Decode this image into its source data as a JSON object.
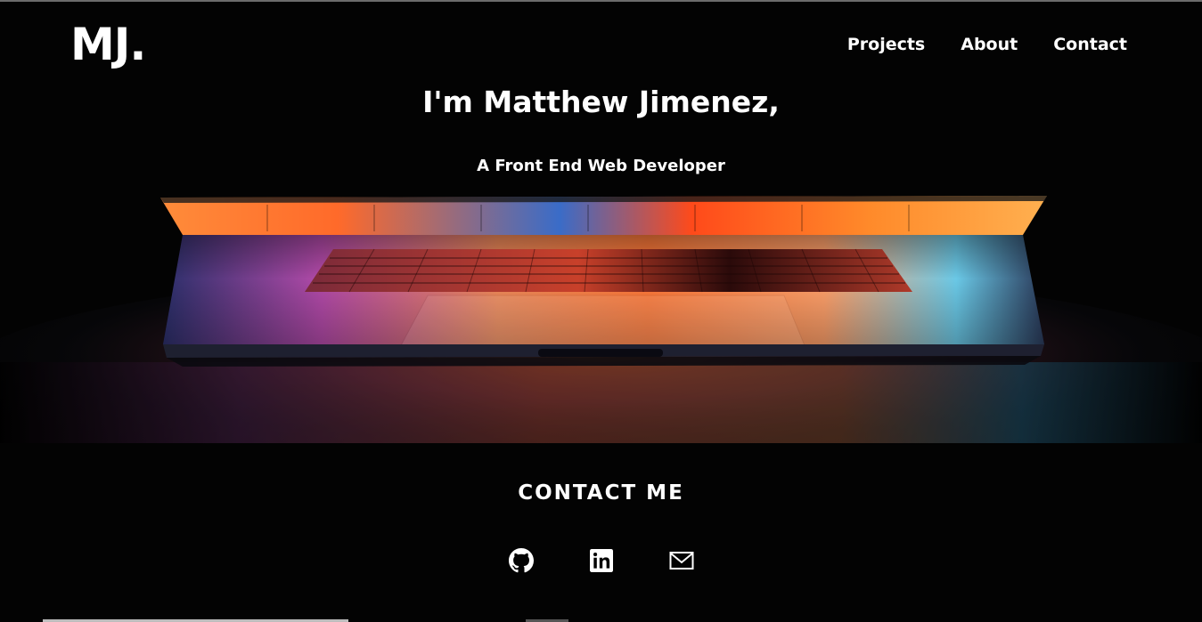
{
  "header": {
    "logo": "MJ.",
    "nav": [
      {
        "label": "Projects"
      },
      {
        "label": "About"
      },
      {
        "label": "Contact"
      }
    ]
  },
  "hero": {
    "heading": "I'm Matthew Jimenez,",
    "subheading": "A Front End Web Developer"
  },
  "contact": {
    "title": "CONTACT ME",
    "links": [
      {
        "icon": "github-icon"
      },
      {
        "icon": "linkedin-icon"
      },
      {
        "icon": "email-icon"
      }
    ]
  },
  "colors": {
    "background": "#030303",
    "text": "#ffffff",
    "accent_orange": "#ff7a2a",
    "accent_pink": "#d84aa8",
    "accent_cyan": "#3ec3e6"
  }
}
